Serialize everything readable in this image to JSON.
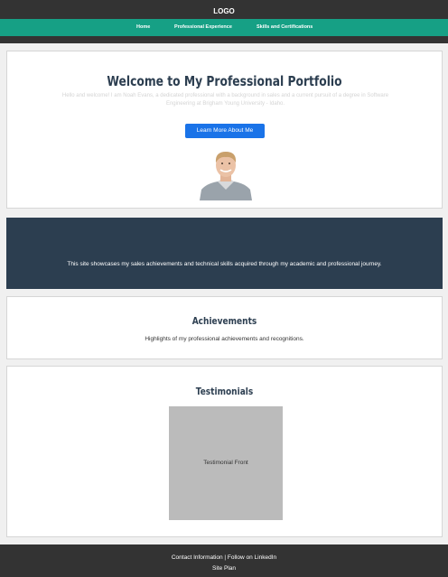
{
  "header": {
    "logo": "LOGO",
    "nav": [
      "Home",
      "Professional Experience",
      "Skills and Certifications"
    ]
  },
  "hero": {
    "title": "Welcome to My Professional Portfolio",
    "intro_line1": "Hello and welcome! I am Noah Evans, a dedicated professional with a background in sales and a current pursuit of a degree in Software",
    "intro_line2": "Engineering at Brigham Young University - Idaho.",
    "button_label": "Learn More About Me"
  },
  "banner": {
    "text": "This site showcases my sales achievements and technical skills acquired through my academic and professional journey."
  },
  "achievements": {
    "title": "Achievements",
    "text": "Highlights of my professional achievements and recognitions."
  },
  "testimonials": {
    "title": "Testimonials",
    "card_label": "Testimonial Front"
  },
  "footer": {
    "contact": "Contact Information",
    "separator": "|",
    "linkedin": "Follow on LinkedIn",
    "site_plan": "Site Plan"
  },
  "colors": {
    "header": "#333333",
    "nav": "#16a085",
    "banner": "#2c3e50",
    "button": "#1a73e8"
  }
}
